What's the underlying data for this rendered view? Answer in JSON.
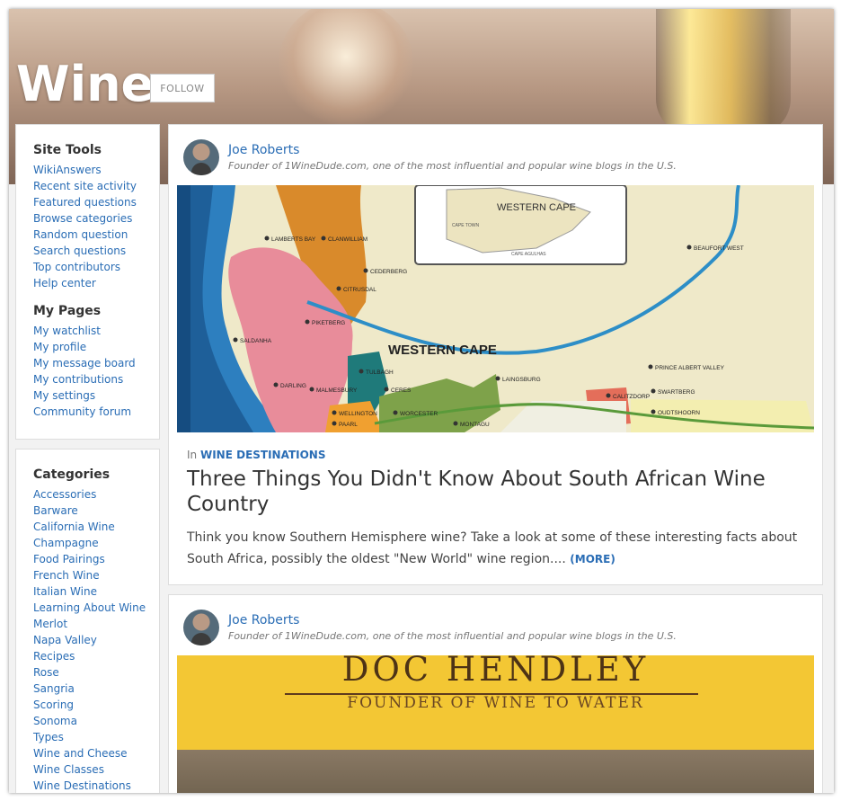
{
  "header": {
    "title": "Wine",
    "follow_label": "FOLLOW"
  },
  "site_tools": {
    "heading": "Site Tools",
    "links": [
      "WikiAnswers",
      "Recent site activity",
      "Featured questions",
      "Browse categories",
      "Random question",
      "Search questions",
      "Top contributors",
      "Help center"
    ]
  },
  "my_pages": {
    "heading": "My Pages",
    "links": [
      "My watchlist",
      "My profile",
      "My message board",
      "My contributions",
      "My settings",
      "Community forum"
    ]
  },
  "categories": {
    "heading": "Categories",
    "links": [
      "Accessories",
      "Barware",
      "California Wine",
      "Champagne",
      "Food Pairings",
      "French Wine",
      "Italian Wine",
      "Learning About Wine",
      "Merlot",
      "Napa Valley",
      "Recipes",
      "Rose",
      "Sangria",
      "Scoring",
      "Sonoma",
      "Types",
      "Wine and Cheese",
      "Wine Classes",
      "Wine Destinations"
    ]
  },
  "articles": [
    {
      "author_name": "Joe Roberts",
      "author_desc": "Founder of 1WineDude.com, one of the most influential and popular wine blogs in the U.S.",
      "category_prefix": "In",
      "category": "WINE DESTINATIONS",
      "title": "Three Things You Didn't Know About South African Wine Country",
      "excerpt": "Think you know Southern Hemisphere wine? Take a look at some of these interesting facts about South Africa, possibly the oldest \"New World\" wine region....",
      "more_label": "(MORE)",
      "map": {
        "region_label": "WESTERN CAPE",
        "inset_label": "WESTERN CAPE",
        "inset_small_1": "CAPE TOWN",
        "inset_small_2": "CAPE AGULHAS",
        "places": [
          "LAMBERTS BAY",
          "CLANWILLIAM",
          "CEDERBERG",
          "CITRUSDAL",
          "PIKETBERG",
          "SALDANHA",
          "DARLING",
          "MALMESBURY",
          "TULBAGH",
          "CERES",
          "WELLINGTON",
          "WORCESTER",
          "PAARL",
          "MONTAGU",
          "LAINGSBURG",
          "BEAUFORT WEST",
          "PRINCE ALBERT VALLEY",
          "SWARTBERG",
          "CALITZDORP",
          "OUDTSHOORN"
        ]
      }
    },
    {
      "author_name": "Joe Roberts",
      "author_desc": "Founder of 1WineDude.com, one of the most influential and popular wine blogs in the U.S.",
      "banner_title": "DOC HENDLEY",
      "banner_subtitle": "FOUNDER OF WINE TO WATER"
    }
  ]
}
